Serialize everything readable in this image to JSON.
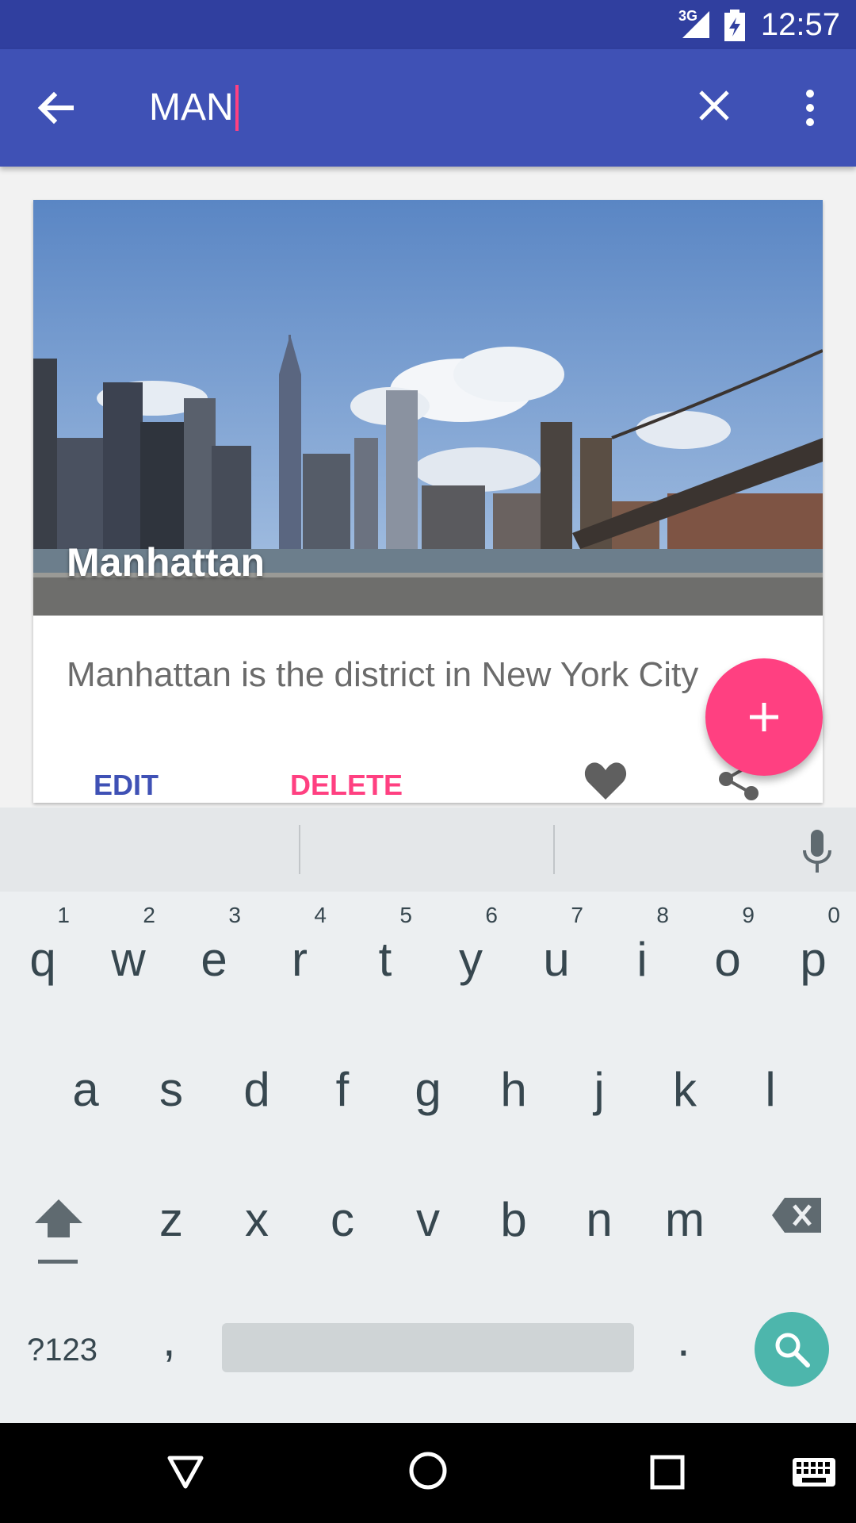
{
  "status_bar": {
    "network": "3G",
    "time": "12:57",
    "icons": [
      "signal-icon",
      "battery-charging-icon"
    ]
  },
  "search_bar": {
    "query": "MAN",
    "icons": [
      "back-arrow-icon",
      "clear-icon",
      "more-vert-icon"
    ]
  },
  "card": {
    "title": "Manhattan",
    "description": "Manhattan is the district in New York City",
    "edit_label": "EDIT",
    "delete_label": "DELETE",
    "icons": [
      "heart-icon",
      "share-icon"
    ]
  },
  "fab": {
    "icon": "plus-icon"
  },
  "keyboard": {
    "row1": [
      {
        "key": "q",
        "num": "1"
      },
      {
        "key": "w",
        "num": "2"
      },
      {
        "key": "e",
        "num": "3"
      },
      {
        "key": "r",
        "num": "4"
      },
      {
        "key": "t",
        "num": "5"
      },
      {
        "key": "y",
        "num": "6"
      },
      {
        "key": "u",
        "num": "7"
      },
      {
        "key": "i",
        "num": "8"
      },
      {
        "key": "o",
        "num": "9"
      },
      {
        "key": "p",
        "num": "0"
      }
    ],
    "row2": [
      "a",
      "s",
      "d",
      "f",
      "g",
      "h",
      "j",
      "k",
      "l"
    ],
    "row3": [
      "z",
      "x",
      "c",
      "v",
      "b",
      "n",
      "m"
    ],
    "symbols_label": "?123",
    "comma": ",",
    "period": "."
  },
  "colors": {
    "primary": "#3f51b5",
    "primary_dark": "#303f9f",
    "accent": "#ff4081",
    "search_key": "#4db6ac"
  }
}
